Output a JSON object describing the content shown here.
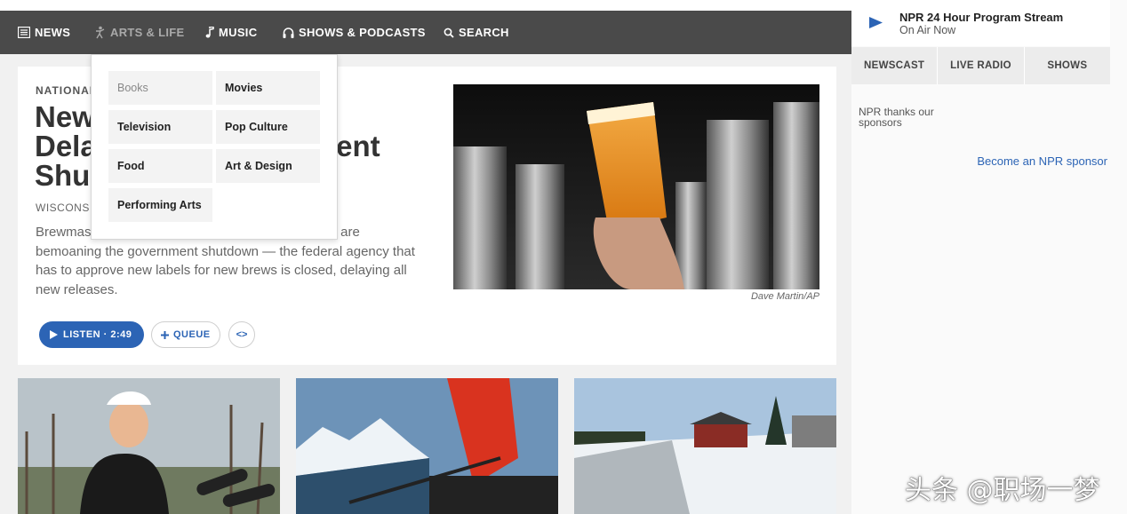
{
  "nav": {
    "items": [
      {
        "label": "NEWS",
        "icon": "news-icon"
      },
      {
        "label": "ARTS & LIFE",
        "icon": "arts-icon"
      },
      {
        "label": "MUSIC",
        "icon": "music-note-icon"
      },
      {
        "label": "SHOWS & PODCASTS",
        "icon": "headphones-icon"
      },
      {
        "label": "SEARCH",
        "icon": "search-icon"
      }
    ]
  },
  "dropdown": {
    "items": [
      "Books",
      "Movies",
      "Television",
      "Pop Culture",
      "Food",
      "Art & Design",
      "Performing Arts"
    ]
  },
  "story": {
    "slug": "NATIONAL",
    "headline_lines": [
      "New",
      "Dela",
      "Shu"
    ],
    "headline_fragment": "nent",
    "dateline": "WISCONSI",
    "teaser_first_start": "Brewmas",
    "teaser_first_end": "ion are",
    "teaser_rest": "bemoaning the government shutdown — the federal agency that has to approve new labels for new brews is closed, delaying all new releases.",
    "listen_label": "LISTEN · 2:49",
    "queue_label": "QUEUE",
    "embed_label": "<>",
    "image_credit": "Dave Martin/AP"
  },
  "sidebar": {
    "stream_title": "NPR 24 Hour Program Stream",
    "stream_status": "On Air Now",
    "tabs": [
      "NEWSCAST",
      "LIVE RADIO",
      "SHOWS"
    ],
    "sponsor_note": "NPR thanks our sponsors",
    "sponsor_link": "Become an NPR sponsor"
  },
  "watermark": "头条 @职场一梦",
  "colors": {
    "navbar": "#4a4a4a",
    "accent_blue": "#2c64b5",
    "page_bg": "#f1f1f1"
  }
}
